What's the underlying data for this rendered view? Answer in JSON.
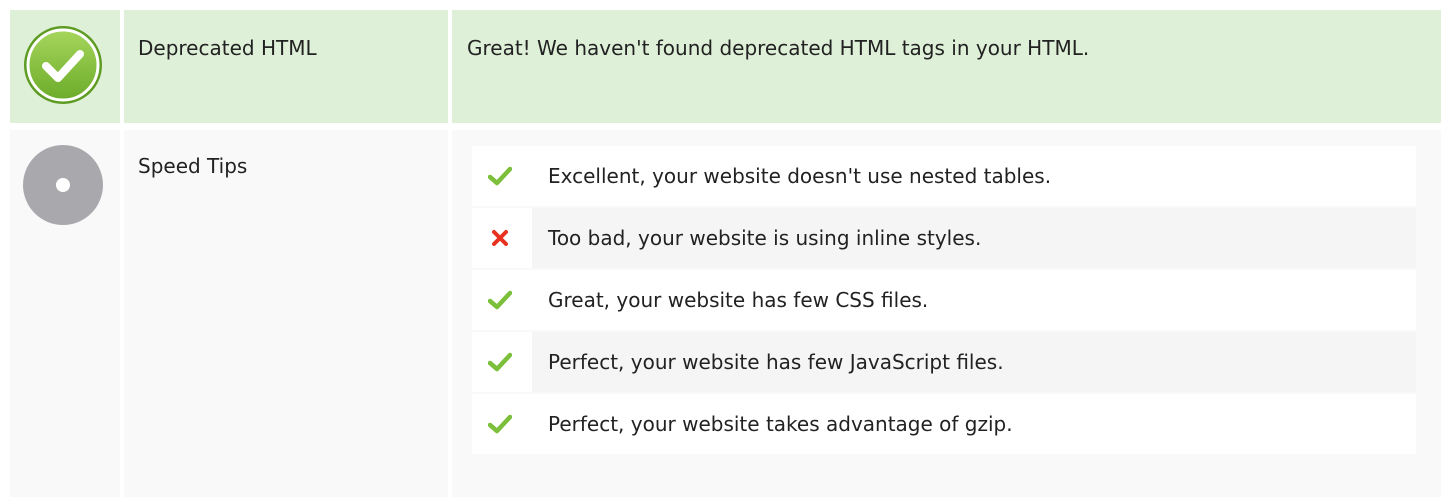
{
  "rows": [
    {
      "status": "pass",
      "status_icon": "check-circle-icon",
      "title": "Deprecated HTML",
      "body": "Great! We haven't found deprecated HTML tags in your HTML."
    },
    {
      "status": "neutral",
      "status_icon": "info-circle-icon",
      "title": "Speed Tips",
      "tips": [
        {
          "result": "pass",
          "icon": "checkmark-icon",
          "text": "Excellent, your website doesn't use nested tables."
        },
        {
          "result": "fail",
          "icon": "cross-icon",
          "text": "Too bad, your website is using inline styles."
        },
        {
          "result": "pass",
          "icon": "checkmark-icon",
          "text": "Great, your website has few CSS files."
        },
        {
          "result": "pass",
          "icon": "checkmark-icon",
          "text": "Perfect, your website has few JavaScript files."
        },
        {
          "result": "pass",
          "icon": "checkmark-icon",
          "text": "Perfect, your website takes advantage of gzip."
        }
      ]
    }
  ],
  "colors": {
    "pass_row_bg": "#dff0d8",
    "neutral_row_bg": "#f9f9f9",
    "pass_green": "#7bbf3a",
    "fail_red": "#e8321f",
    "neutral_grey": "#a9a9ad"
  }
}
